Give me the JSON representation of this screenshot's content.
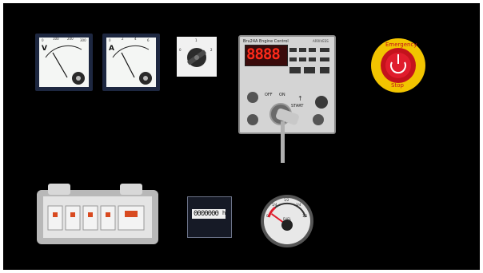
{
  "voltmeter": {
    "letter": "V",
    "scale": [
      "0",
      "100",
      "200",
      "300"
    ]
  },
  "ammeter": {
    "letter": "A",
    "scale": [
      "0",
      "2",
      "4",
      "6"
    ]
  },
  "selector_switch": {
    "positions": [
      "0",
      "1",
      "2"
    ]
  },
  "engine_control": {
    "title": "Bru24A Engine Control",
    "subtitle": "ARRIVESS",
    "display": "8888",
    "key_positions": {
      "off": "OFF",
      "on": "ON",
      "start": "START"
    },
    "start_arrow": "↑"
  },
  "emergency_stop": {
    "top_text": "Emergency",
    "bottom_text": "Stop"
  },
  "hour_meter": {
    "digits": "0000000",
    "unit": "h"
  },
  "fuel_gauge": {
    "scale": [
      "0",
      "1/4",
      "1/2",
      "3/4",
      "1/1"
    ],
    "label": "FUEL",
    "level": 0.2
  },
  "colors": {
    "background": "#000000",
    "estop_yellow": "#f2c400",
    "estop_red": "#e01c2c",
    "led_red": "#ff2a1a"
  }
}
